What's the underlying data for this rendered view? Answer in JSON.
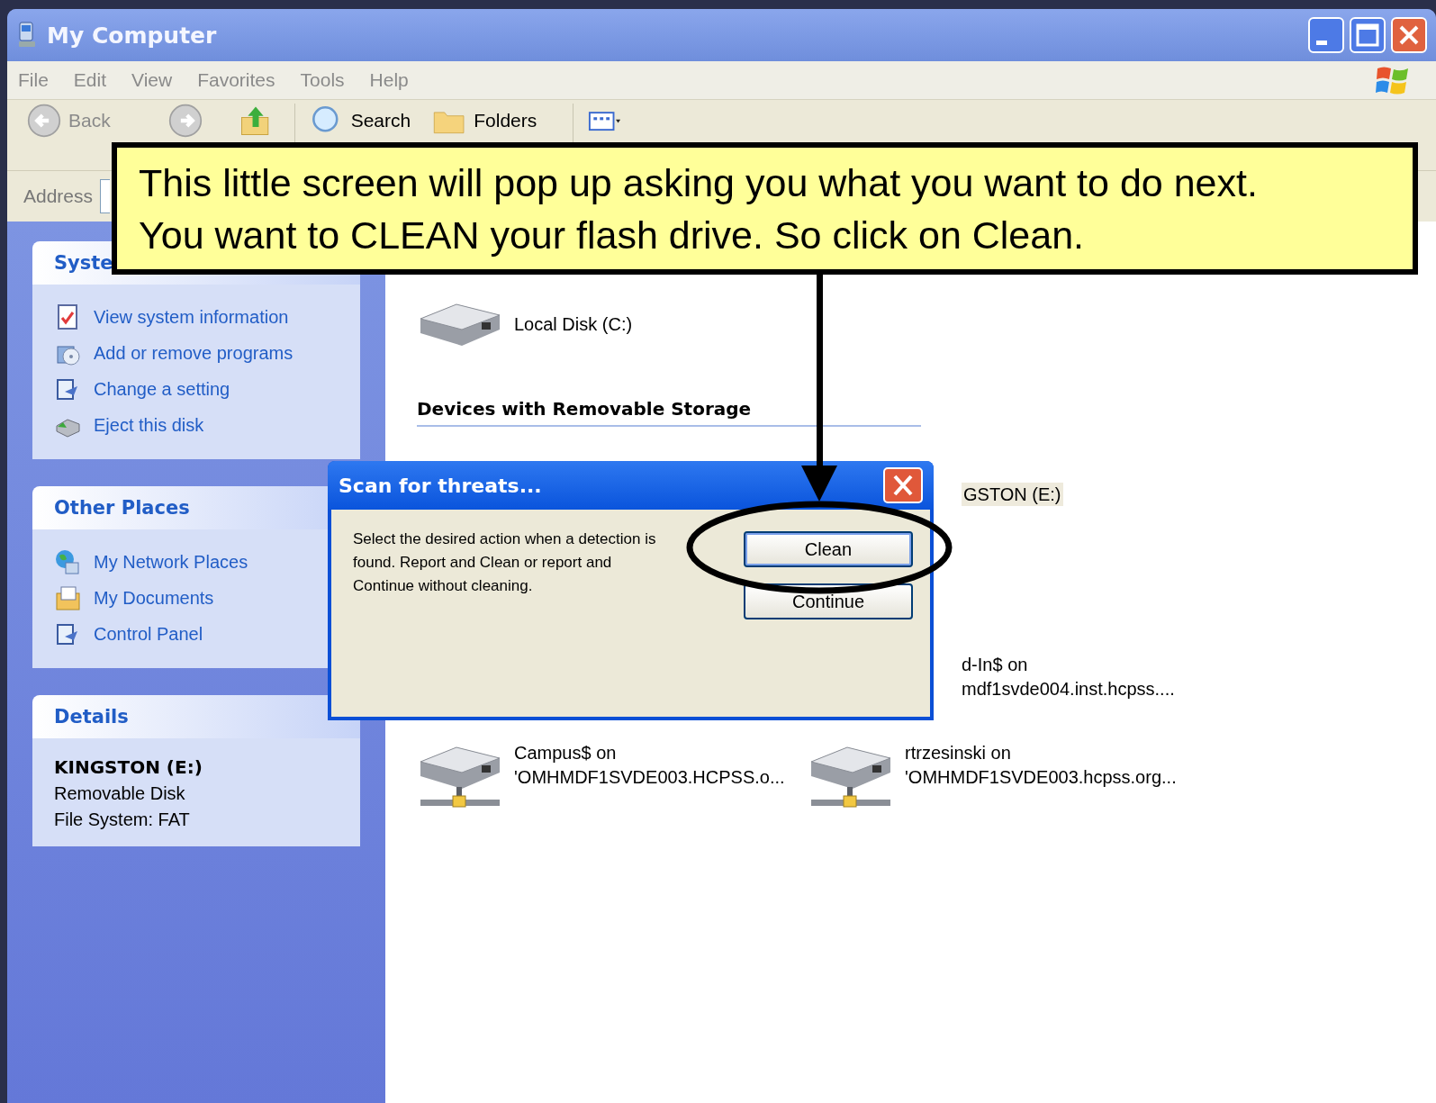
{
  "window": {
    "title": "My Computer"
  },
  "menu": [
    "File",
    "Edit",
    "View",
    "Favorites",
    "Tools",
    "Help"
  ],
  "toolbar": {
    "back": "Back",
    "search": "Search",
    "folders": "Folders"
  },
  "address": {
    "label": "Address"
  },
  "sidebar": {
    "panels": [
      {
        "title": "Syste",
        "kind": "links",
        "items": [
          "View system information",
          "Add or remove programs",
          "Change a setting",
          "Eject this disk"
        ]
      },
      {
        "title": "Other Places",
        "kind": "links",
        "items": [
          "My Network Places",
          "My Documents",
          "Control Panel"
        ]
      },
      {
        "title": "Details",
        "kind": "details",
        "name": "KINGSTON (E:)",
        "items": [
          "Removable Disk",
          "File System: FAT"
        ]
      }
    ]
  },
  "content": {
    "local_drive": "Local Disk (C:)",
    "removable_heading": "Devices with Removable Storage",
    "removable_fragment": "GSTON (E:)",
    "network_fragment": [
      "d-In$ on",
      "mdf1svde004.inst.hcpss...."
    ],
    "network_drives": [
      {
        "name": "Campus$ on",
        "path": "'OMHMDF1SVDE003.HCPSS.o..."
      },
      {
        "name": "rtrzesinski on",
        "path": "'OMHMDF1SVDE003.hcpss.org..."
      }
    ]
  },
  "dialog": {
    "title": "Scan for threats...",
    "message": "Select the desired action when a detection is found. Report and Clean  or report and Continue without cleaning.",
    "buttons": [
      {
        "label": "Clean",
        "default": true
      },
      {
        "label": "Continue",
        "default": false
      }
    ]
  },
  "callout": {
    "text": "This little screen will pop up asking you what you want to do next.\nYou want to CLEAN your flash drive. So click on Clean."
  }
}
